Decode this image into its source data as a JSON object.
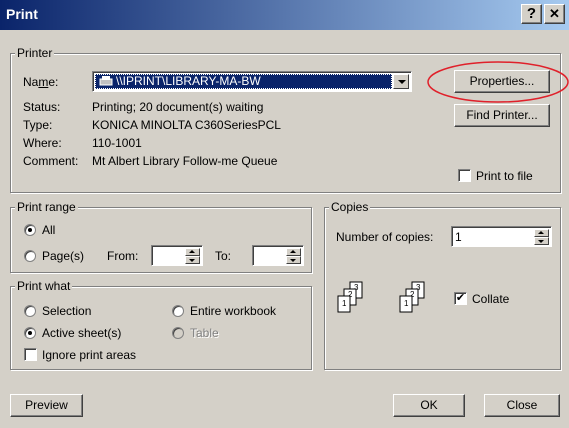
{
  "window": {
    "title": "Print",
    "help_label": "?",
    "close_label": "✕"
  },
  "printer": {
    "group_label": "Printer",
    "name_label": "Name:",
    "name_value": "\\\\IPRINT\\LIBRARY-MA-BW",
    "status_label": "Status:",
    "status_value": "Printing; 20 document(s) waiting",
    "type_label": "Type:",
    "type_value": "KONICA MINOLTA C360SeriesPCL",
    "where_label": "Where:",
    "where_value": "110-1001",
    "comment_label": "Comment:",
    "comment_value": "Mt Albert Library Follow-me Queue",
    "properties_button": "Properties...",
    "find_printer_button": "Find Printer...",
    "print_to_file_label": "Print to file",
    "print_to_file_checked": false
  },
  "print_range": {
    "group_label": "Print range",
    "all_label": "All",
    "pages_label": "Page(s)",
    "from_label": "From:",
    "to_label": "To:",
    "from_value": "",
    "to_value": "",
    "selected": "all"
  },
  "print_what": {
    "group_label": "Print what",
    "selection_label": "Selection",
    "entire_workbook_label": "Entire workbook",
    "active_sheets_label": "Active sheet(s)",
    "table_label": "Table",
    "ignore_print_areas_label": "Ignore print areas",
    "selected": "active_sheets"
  },
  "copies": {
    "group_label": "Copies",
    "number_label": "Number of copies:",
    "number_value": "1",
    "collate_label": "Collate",
    "collate_checked": true,
    "collate_icon_pages": [
      "1",
      "2",
      "3",
      "1",
      "2",
      "3"
    ]
  },
  "footer": {
    "preview_button": "Preview",
    "ok_button": "OK",
    "close_button": "Close"
  },
  "annotation": {
    "color": "#e0202a",
    "shape": "ellipse"
  }
}
